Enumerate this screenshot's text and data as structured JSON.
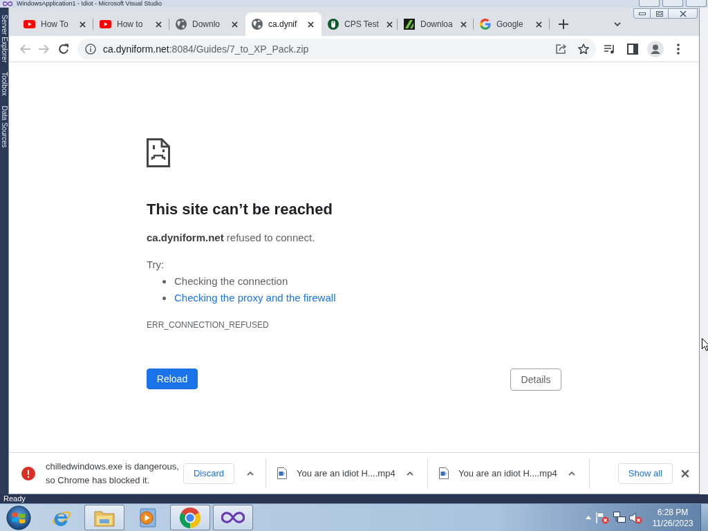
{
  "background_window": {
    "title": "WindowsApplication1 - Idiot - Microsoft Visual Studio",
    "side_tabs": [
      "Server Explorer",
      "Toolbox",
      "Data Sources"
    ],
    "status": "Ready"
  },
  "browser": {
    "tabs": [
      {
        "kind": "video",
        "title": "How To",
        "selected": false
      },
      {
        "kind": "video",
        "title": "How to",
        "selected": false
      },
      {
        "kind": "globe",
        "title": "Downlo",
        "selected": false
      },
      {
        "kind": "globe",
        "title": "ca.dynif",
        "selected": true
      },
      {
        "kind": "mouse",
        "title": "CPS Test",
        "selected": false
      },
      {
        "kind": "stripes",
        "title": "Downloa",
        "selected": false
      },
      {
        "kind": "google",
        "title": "Google",
        "selected": false
      }
    ],
    "toolbar": {
      "back": {
        "disabled": true
      },
      "forward": {
        "disabled": true
      },
      "address": {
        "host": "ca.dyniform.net",
        "rest": ":8084/Guides/7_to_XP_Pack.zip"
      }
    }
  },
  "page": {
    "heading": "This site can’t be reached",
    "message": "**ca.dyniform.net** refused to connect.",
    "try_label": "Try:",
    "suggestions": [
      {
        "kind": "text",
        "text": "Checking the connection"
      },
      {
        "kind": "link",
        "text": "Checking the proxy and the firewall"
      }
    ],
    "error_code": "ERR_CONNECTION_REFUSED",
    "buttons": [
      {
        "kind": "primary",
        "label": "Reload"
      },
      {
        "kind": "secondary",
        "label": "Details"
      }
    ]
  },
  "downloads": {
    "items": [
      {
        "kind": "blocked",
        "message": "chilledwindows.exe is dangerous,\nso Chrome has blocked it.",
        "action": "Discard"
      },
      {
        "kind": "file",
        "name": "You are an idiot H....mp4"
      },
      {
        "kind": "file",
        "name": "You are an idiot H....mp4"
      }
    ],
    "show_all": "Show all"
  },
  "taskbar": {
    "apps": [
      {
        "kind": "ie",
        "running": false
      },
      {
        "kind": "explorer",
        "running": true
      },
      {
        "kind": "media",
        "running": false
      },
      {
        "kind": "chrome",
        "running": true
      },
      {
        "kind": "vs",
        "running": true
      }
    ],
    "clock": {
      "time": "6:28 PM",
      "date": "11/26/2023"
    }
  }
}
